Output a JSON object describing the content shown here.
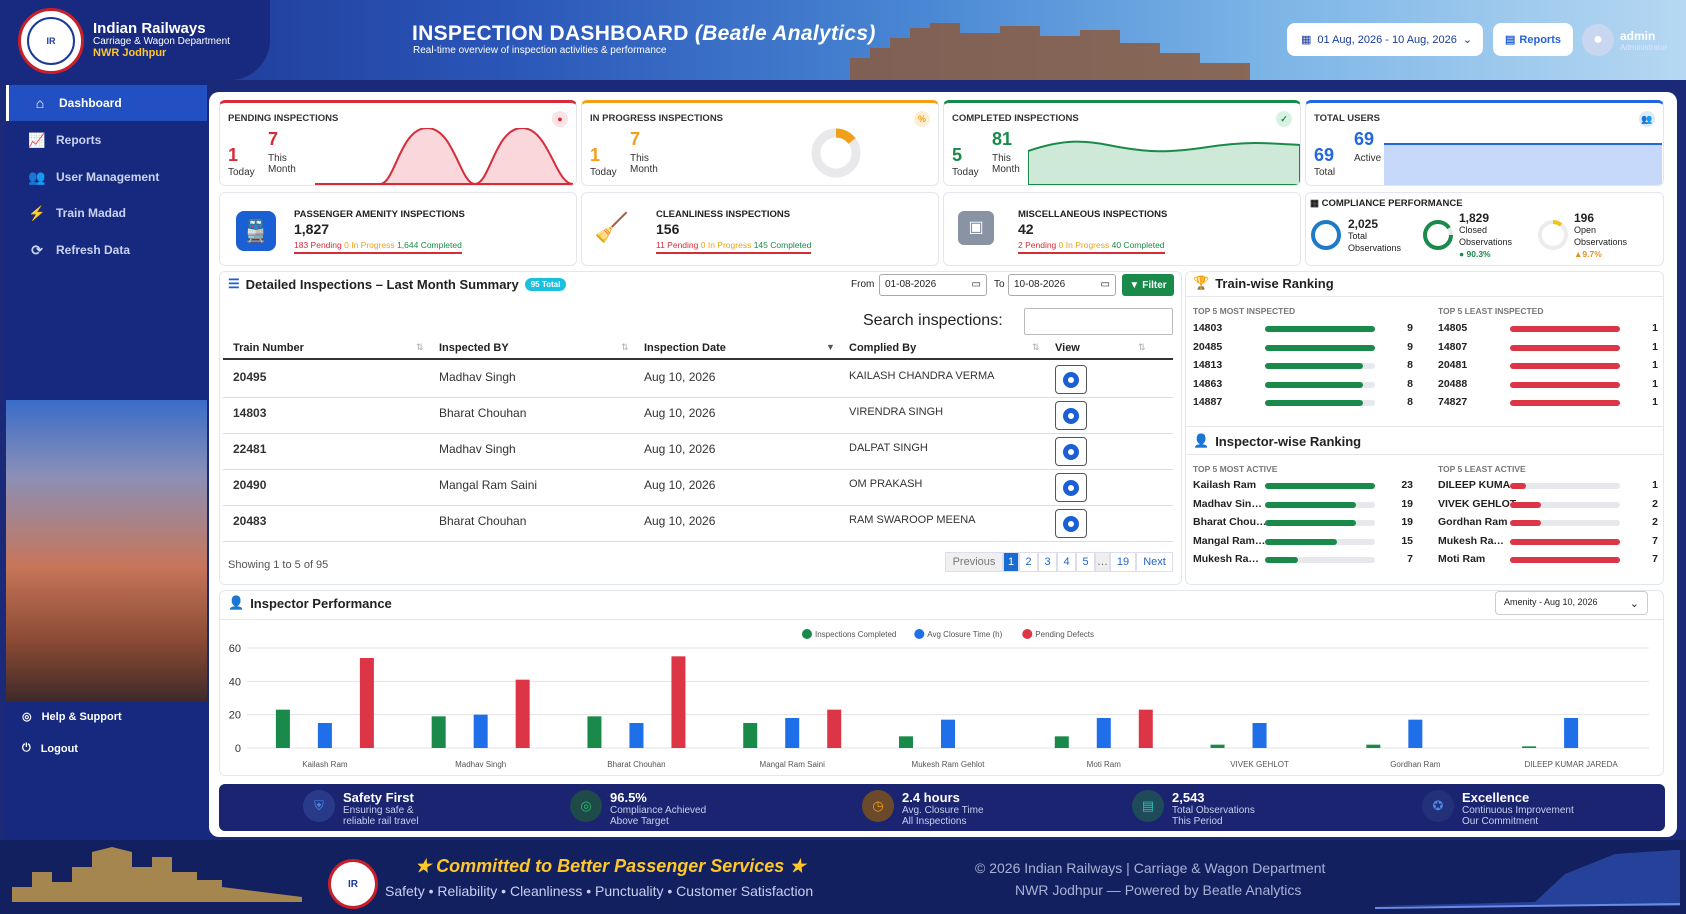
{
  "header": {
    "org": "Indian Railways",
    "dept": "Carriage & Wagon Department",
    "zone": "NWR Jodhpur",
    "title": "INSPECTION DASHBOARD",
    "title_em": "(Beatle Analytics)",
    "subtitle": "Real-time overview of inspection activities & performance",
    "date_range": "01 Aug, 2026 - 10 Aug, 2026",
    "reports_label": "Reports",
    "user_name": "admin",
    "user_role": "Administrator"
  },
  "nav": {
    "items": [
      {
        "label": "Dashboard",
        "icon": "home-icon"
      },
      {
        "label": "Reports",
        "icon": "chart-line-icon"
      },
      {
        "label": "User Management",
        "icon": "users-icon"
      },
      {
        "label": "Train Madad",
        "icon": "bolt-icon"
      },
      {
        "label": "Refresh Data",
        "icon": "refresh-icon"
      }
    ],
    "help": "Help & Support",
    "logout": "Logout"
  },
  "kpis": [
    {
      "title": "PENDING INSPECTIONS",
      "today": "1",
      "today_label": "Today",
      "month": "7",
      "month_label": "This Month",
      "color": "#d62c3a"
    },
    {
      "title": "IN PROGRESS INSPECTIONS",
      "today": "1",
      "today_label": "Today",
      "month": "7",
      "month_label": "This Month",
      "color": "#f2a019"
    },
    {
      "title": "COMPLETED INSPECTIONS",
      "today": "5",
      "today_label": "Today",
      "month": "81",
      "month_label": "This Month",
      "color": "#1a8a4a"
    },
    {
      "title": "TOTAL USERS",
      "today": "69",
      "today_label": "Total",
      "month": "69",
      "month_label": "Active",
      "color": "#2266e0"
    }
  ],
  "categories": [
    {
      "title": "PASSENGER AMENITY INSPECTIONS",
      "value": "1,827",
      "pending": "183 Pending",
      "progress": "0 In Progress",
      "completed": "1,644 Completed",
      "icon": "train-icon"
    },
    {
      "title": "CLEANLINESS INSPECTIONS",
      "value": "156",
      "pending": "11 Pending",
      "progress": "0 In Progress",
      "completed": "145 Completed",
      "icon": "cleaning-icon"
    },
    {
      "title": "MISCELLANEOUS INSPECTIONS",
      "value": "42",
      "pending": "2 Pending",
      "progress": "0 In Progress",
      "completed": "40 Completed",
      "icon": "robot-icon"
    }
  ],
  "compliance": {
    "title": "COMPLIANCE PERFORMANCE",
    "total": "2,025",
    "total_label1": "Total",
    "total_label2": "Observations",
    "closed": "1,829",
    "closed_label1": "Closed",
    "closed_label2": "Observations",
    "closed_pct": "90.3%",
    "open": "196",
    "open_label1": "Open",
    "open_label2": "Observations",
    "open_pct": "9.7%"
  },
  "table": {
    "title": "Detailed Inspections – Last Month Summary",
    "total_badge": "95 Total",
    "from_label": "From",
    "from": "01-08-2026",
    "to_label": "To",
    "to": "10-08-2026",
    "filter": "Filter",
    "search_label": "Search inspections:",
    "headers": [
      "Train Number",
      "Inspected BY",
      "Inspection Date",
      "Complied By",
      "View"
    ],
    "rows": [
      [
        "20495",
        "Madhav Singh",
        "Aug 10, 2026",
        "KAILASH CHANDRA VERMA"
      ],
      [
        "14803",
        "Bharat Chouhan",
        "Aug 10, 2026",
        "VIRENDRA SINGH"
      ],
      [
        "22481",
        "Madhav Singh",
        "Aug 10, 2026",
        "DALPAT SINGH"
      ],
      [
        "20490",
        "Mangal Ram Saini",
        "Aug 10, 2026",
        "OM PRAKASH"
      ],
      [
        "20483",
        "Bharat Chouhan",
        "Aug 10, 2026",
        "RAM SWAROOP MEENA"
      ]
    ],
    "showing": "Showing 1 to 5 of 95",
    "pages": [
      "Previous",
      "1",
      "2",
      "3",
      "4",
      "5",
      "…",
      "19",
      "Next"
    ]
  },
  "train_rank": {
    "title": "Train-wise Ranking",
    "most_label": "TOP 5 MOST INSPECTED",
    "least_label": "TOP 5 LEAST INSPECTED",
    "most": [
      [
        "14803",
        "9"
      ],
      [
        "20485",
        "9"
      ],
      [
        "14813",
        "8"
      ],
      [
        "14863",
        "8"
      ],
      [
        "14887",
        "8"
      ]
    ],
    "least": [
      [
        "14805",
        "1"
      ],
      [
        "14807",
        "1"
      ],
      [
        "20481",
        "1"
      ],
      [
        "20488",
        "1"
      ],
      [
        "74827",
        "1"
      ]
    ]
  },
  "inspector_rank": {
    "title": "Inspector-wise Ranking",
    "most_label": "TOP 5 MOST ACTIVE",
    "least_label": "TOP 5 LEAST ACTIVE",
    "most": [
      [
        "Kailash Ram",
        "23"
      ],
      [
        "Madhav Sin…",
        "19"
      ],
      [
        "Bharat Chou…",
        "19"
      ],
      [
        "Mangal Ram…",
        "15"
      ],
      [
        "Mukesh Ra…",
        "7"
      ]
    ],
    "least": [
      [
        "DILEEP KUMA…",
        "1"
      ],
      [
        "VIVEK GEHLOT",
        "2"
      ],
      [
        "Gordhan Ram",
        "2"
      ],
      [
        "Mukesh Ra…",
        "7"
      ],
      [
        "Moti Ram",
        "7"
      ]
    ]
  },
  "perf": {
    "title": "Inspector Performance",
    "select": "Amenity - Aug 10, 2026"
  },
  "chart_data": {
    "type": "bar",
    "categories": [
      "Kailash Ram",
      "Madhav Singh",
      "Bharat Chouhan",
      "Mangal Ram Saini",
      "Mukesh Ram Gehlot",
      "Moti Ram",
      "VIVEK GEHLOT",
      "Gordhan Ram",
      "DILEEP KUMAR JAREDA"
    ],
    "series": [
      {
        "name": "Inspections Completed",
        "color": "#1a8a4a",
        "values": [
          23,
          19,
          19,
          15,
          7,
          7,
          2,
          2,
          1
        ]
      },
      {
        "name": "Avg Closure Time (h)",
        "color": "#1f6fe8",
        "values": [
          15,
          20,
          15,
          18,
          17,
          18,
          15,
          17,
          18
        ]
      },
      {
        "name": "Pending Defects",
        "color": "#dc3545",
        "values": [
          54,
          41,
          55,
          23,
          0,
          23,
          0,
          0,
          0
        ]
      }
    ],
    "ylim": [
      0,
      60
    ],
    "yticks": [
      "0",
      "20",
      "40",
      "60"
    ],
    "legend": "top"
  },
  "strip": [
    {
      "a": "Safety First",
      "b1": "Ensuring safe &",
      "b2": "reliable rail travel",
      "icon": "shield-icon",
      "color": "#2a5fd4"
    },
    {
      "a": "96.5%",
      "b1": "Compliance Achieved",
      "b2": "Above Target",
      "icon": "target-icon",
      "color": "#1a8a4a"
    },
    {
      "a": "2.4 hours",
      "b1": "Avg. Closure Time",
      "b2": "All Inspections",
      "icon": "clock-icon",
      "color": "#e8901a"
    },
    {
      "a": "2,543",
      "b1": "Total Observations",
      "b2": "This Period",
      "icon": "clipboard-icon",
      "color": "#1a9a8a"
    },
    {
      "a": "Excellence",
      "b1": "Continuous Improvement",
      "b2": "Our Commitment",
      "icon": "award-icon",
      "color": "#2a6ae0"
    }
  ],
  "footer": {
    "tag": "Committed to Better Passenger Services",
    "star": "★",
    "values": "Safety • Reliability • Cleanliness • Punctuality • Customer Satisfaction",
    "copy1": "© 2026 Indian Railways | Carriage & Wagon Department",
    "copy2": "NWR Jodhpur — Powered by Beatle Analytics"
  }
}
